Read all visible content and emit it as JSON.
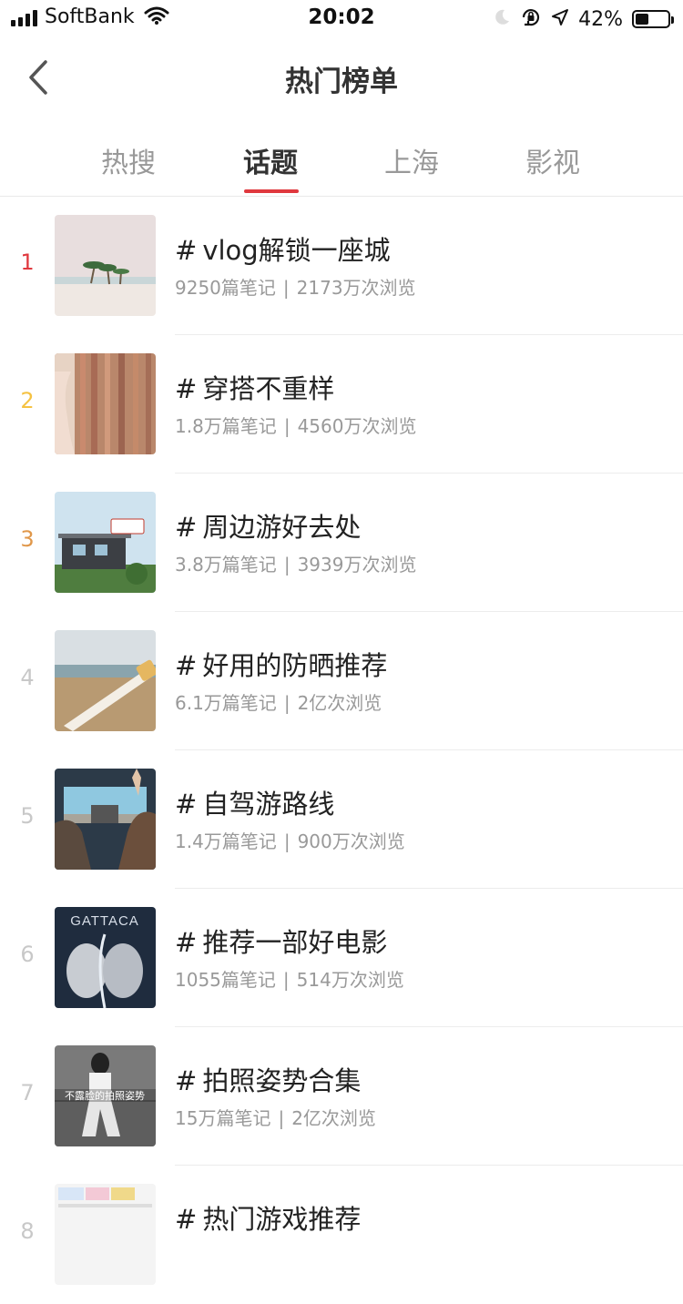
{
  "status_bar": {
    "carrier": "SoftBank",
    "time": "20:02",
    "battery_percent": "42%",
    "battery_level": 0.42,
    "icons": [
      "signal-icon",
      "wifi-icon",
      "moon-icon",
      "orientation-lock-icon",
      "location-arrow-icon",
      "battery-icon"
    ]
  },
  "nav": {
    "back_icon": "chevron-left-icon",
    "title": "热门榜单"
  },
  "tabs": [
    {
      "label": "热搜",
      "active": false
    },
    {
      "label": "话题",
      "active": true
    },
    {
      "label": "上海",
      "active": false
    },
    {
      "label": "影视",
      "active": false
    }
  ],
  "colors": {
    "accent": "#e0383e",
    "rank1": "#e0383e",
    "rank2": "#f5c242",
    "rank3": "#e0974a",
    "rank_other": "#c8c8c8",
    "text_primary": "#222222",
    "text_secondary": "#999999"
  },
  "topics": [
    {
      "rank": "1",
      "hash": "#",
      "title": "vlog解锁一座城",
      "notes": "9250篇笔记",
      "sep": "|",
      "views": "2173万次浏览"
    },
    {
      "rank": "2",
      "hash": "#",
      "title": "穿搭不重样",
      "notes": "1.8万篇笔记",
      "sep": "|",
      "views": "4560万次浏览"
    },
    {
      "rank": "3",
      "hash": "#",
      "title": "周边游好去处",
      "notes": "3.8万篇笔记",
      "sep": "|",
      "views": "3939万次浏览"
    },
    {
      "rank": "4",
      "hash": "#",
      "title": "好用的防晒推荐",
      "notes": "6.1万篇笔记",
      "sep": "|",
      "views": "2亿次浏览"
    },
    {
      "rank": "5",
      "hash": "#",
      "title": "自驾游路线",
      "notes": "1.4万篇笔记",
      "sep": "|",
      "views": "900万次浏览"
    },
    {
      "rank": "6",
      "hash": "#",
      "title": "推荐一部好电影",
      "notes": "1055篇笔记",
      "sep": "|",
      "views": "514万次浏览",
      "thumb_text": "GATTACA"
    },
    {
      "rank": "7",
      "hash": "#",
      "title": "拍照姿势合集",
      "notes": "15万篇笔记",
      "sep": "|",
      "views": "2亿次浏览",
      "thumb_text": "不露脸的拍照姿势"
    },
    {
      "rank": "8",
      "hash": "#",
      "title": "热门游戏推荐",
      "notes": "",
      "sep": "",
      "views": ""
    }
  ]
}
